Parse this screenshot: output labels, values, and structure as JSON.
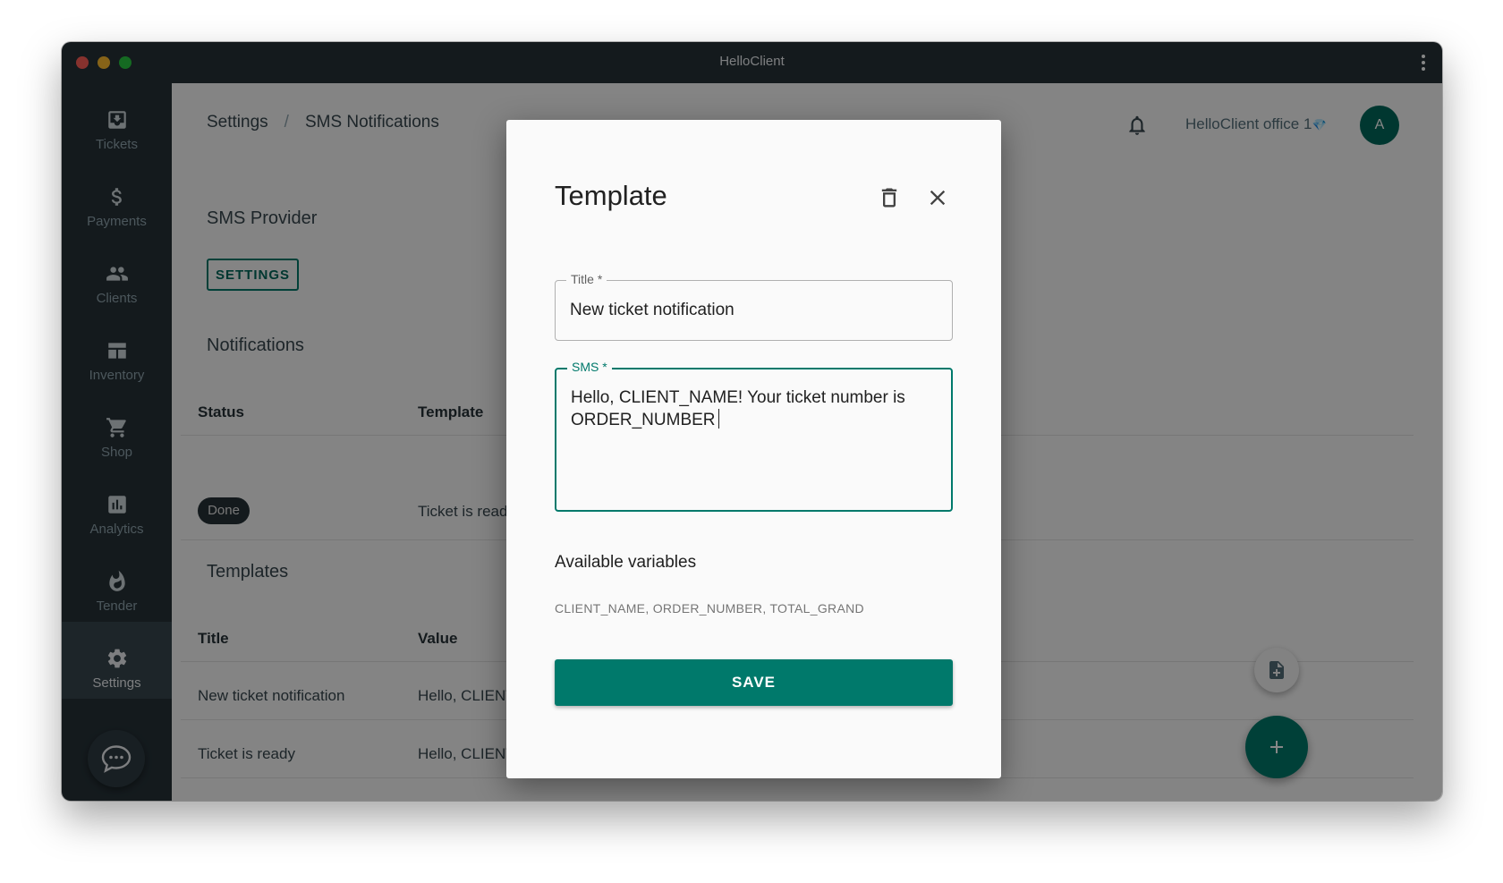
{
  "window": {
    "title": "HelloClient"
  },
  "sidebar": {
    "items": [
      {
        "label": "Tickets",
        "icon": "ticket-download-icon"
      },
      {
        "label": "Payments",
        "icon": "dollar-icon"
      },
      {
        "label": "Clients",
        "icon": "people-icon"
      },
      {
        "label": "Inventory",
        "icon": "inventory-icon"
      },
      {
        "label": "Shop",
        "icon": "cart-icon"
      },
      {
        "label": "Analytics",
        "icon": "bar-chart-icon"
      },
      {
        "label": "Tender",
        "icon": "flame-icon"
      },
      {
        "label": "Settings",
        "icon": "gear-icon",
        "active": true
      }
    ],
    "chat_icon": "chat-bubble-icon"
  },
  "header": {
    "breadcrumb": [
      "Settings",
      "SMS Notifications"
    ],
    "separator": "/",
    "office": "HelloClient office 1",
    "office_gem": "💎",
    "avatar_initial": "A"
  },
  "sms_provider": {
    "title": "SMS Provider",
    "button": "SETTINGS"
  },
  "notifications": {
    "title": "Notifications",
    "columns": [
      "Status",
      "Template"
    ],
    "rows": [
      {
        "status": "Done",
        "template": "Ticket is ready"
      }
    ]
  },
  "templates": {
    "title": "Templates",
    "columns": [
      "Title",
      "Value"
    ],
    "rows": [
      {
        "title": "New ticket notification",
        "value": "Hello, CLIENT_NAME"
      },
      {
        "title": "Ticket is ready",
        "value": "Hello, CLIENT_NAME"
      }
    ]
  },
  "dialog": {
    "title": "Template",
    "title_field": {
      "label": "Title *",
      "value": "New ticket notification"
    },
    "sms_field": {
      "label": "SMS *",
      "line1": "Hello, CLIENT_NAME! Your ticket number is",
      "line2": "ORDER_NUMBER"
    },
    "variables_title": "Available variables",
    "variables": "CLIENT_NAME, ORDER_NUMBER, TOTAL_GRAND",
    "save": "SAVE"
  },
  "colors": {
    "accent": "#00796b",
    "sidebar": "#263238",
    "titlebar": "#263238"
  }
}
